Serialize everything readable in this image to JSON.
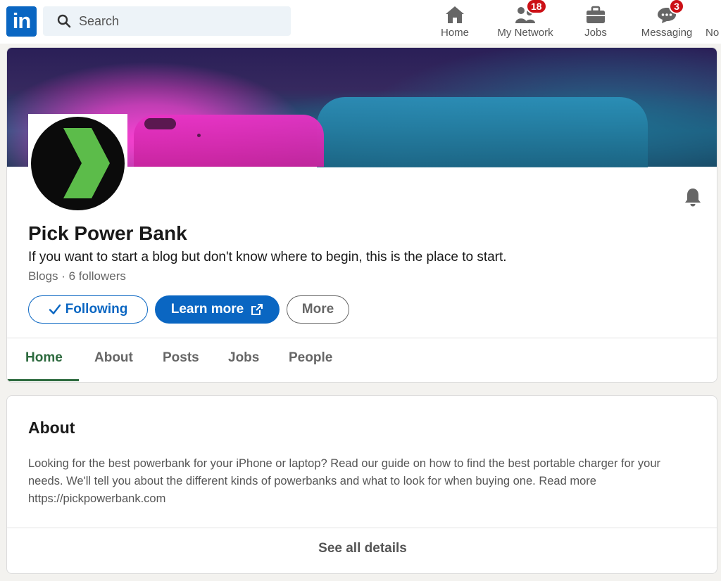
{
  "topnav": {
    "logo_text": "in",
    "search": {
      "placeholder": "Search"
    },
    "items": [
      {
        "label": "Home",
        "icon": "home-icon"
      },
      {
        "label": "My Network",
        "icon": "network-icon",
        "badge": "18"
      },
      {
        "label": "Jobs",
        "icon": "briefcase-icon"
      },
      {
        "label": "Messaging",
        "icon": "messaging-icon",
        "badge": "3"
      },
      {
        "label": "No",
        "icon": "notifications-icon"
      }
    ]
  },
  "company": {
    "name": "Pick Power Bank",
    "tagline": "If you want to start a blog but don't know where to begin, this is the place to start.",
    "meta": "Blogs · 6 followers",
    "buttons": {
      "following": "Following",
      "learn_more": "Learn more",
      "more": "More"
    },
    "tabs": [
      "Home",
      "About",
      "Posts",
      "Jobs",
      "People"
    ],
    "active_tab": "Home"
  },
  "about": {
    "title": "About",
    "text": "Looking for the best powerbank for your iPhone or laptop? Read our guide on how to find the best portable charger for your needs. We'll tell you about the different kinds of powerbanks and what to look for when buying one. Read more https://pickpowerbank.com",
    "see_all": "See all details"
  },
  "colors": {
    "brand_blue": "#0a66c2",
    "active_tab": "#2d6a3e",
    "badge_red": "#cc1016",
    "logo_green": "#5cbc4a"
  }
}
